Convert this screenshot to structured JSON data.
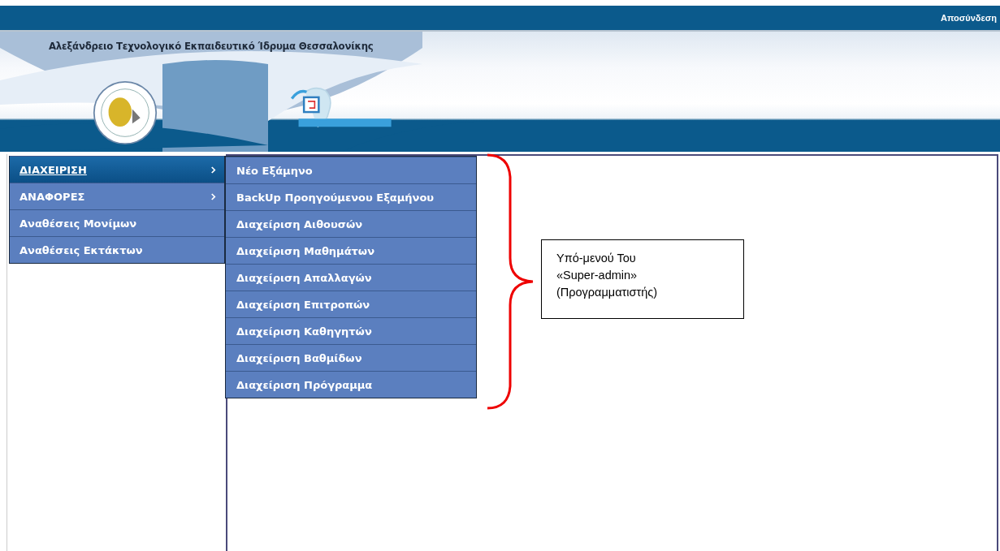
{
  "top_bar": {
    "logout_link": "Αποσύνδεση"
  },
  "header": {
    "title": "Αλεξάνδρειο Τεχνολογικό Εκπαιδευτικό Ίδρυμα Θεσσαλονίκης"
  },
  "menu": {
    "items": [
      {
        "label": "ΔΙΑΧΕΙΡΙΣΗ",
        "selected": true,
        "has_submenu": true
      },
      {
        "label": "ΑΝΑΦΟΡΕΣ",
        "selected": false,
        "has_submenu": true
      },
      {
        "label": "Αναθέσεις Μονίμων",
        "selected": false,
        "has_submenu": false
      },
      {
        "label": "Αναθέσεις Εκτάκτων",
        "selected": false,
        "has_submenu": false
      }
    ]
  },
  "submenu": {
    "items": [
      "Νέο Εξάμηνο",
      "BackUp Προηγούμενου Εξαμήνου",
      "Διαχείριση Αιθουσών",
      "Διαχείριση Μαθημάτων",
      "Διαχείριση Απαλλαγών",
      "Διαχείριση Επιτροπών",
      "Διαχείριση Καθηγητών",
      "Διαχείριση Βαθμίδων",
      "Διαχείριση Πρόγραμμα"
    ]
  },
  "annotation": {
    "lines": [
      "Υπό-μενού Του",
      "«Super-admin»",
      "(Προγραμματιστής)"
    ]
  }
}
